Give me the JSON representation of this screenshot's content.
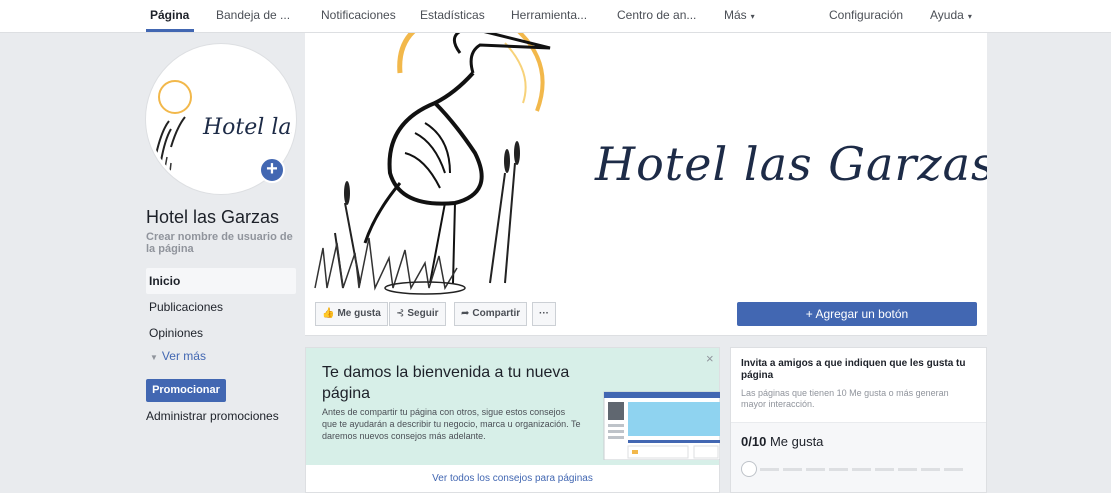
{
  "nav": {
    "items": [
      "Página",
      "Bandeja de ...",
      "Notificaciones",
      "Estadísticas",
      "Herramienta...",
      "Centro de an...",
      "Más",
      "Configuración",
      "Ayuda"
    ],
    "caret": "▾"
  },
  "sidebar": {
    "page_name": "Hotel las Garzas",
    "username_link": "Crear nombre de usuario de la página",
    "profile_text": "Hotel las (",
    "add_icon": "+",
    "nav_items": [
      "Inicio",
      "Publicaciones",
      "Opiniones"
    ],
    "see_more": "Ver más",
    "see_more_icon": "▼",
    "promote": "Promocionar",
    "manage_promos": "Administrar promociones"
  },
  "cover": {
    "title": "Hotel las Garzas"
  },
  "actions": {
    "like": "Me gusta",
    "like_icon": "👍",
    "follow": "Seguir",
    "follow_icon": "⊰",
    "share": "Compartir",
    "share_icon": "➦",
    "more": "···",
    "add_button": "+ Agregar un botón"
  },
  "welcome": {
    "title": "Te damos la bienvenida a tu nueva página",
    "body": "Antes de compartir tu página con otros, sigue estos consejos que te ayudarán a describir tu negocio, marca u organización. Te daremos nuevos consejos más adelante.",
    "close": "×",
    "link": "Ver todos los consejos para páginas"
  },
  "invite": {
    "title": "Invita a amigos a que indiquen que les gusta tu página",
    "subtitle": "Las páginas que tienen 10 Me gusta o más generan mayor interacción.",
    "count": "0/10",
    "count_label": "Me gusta",
    "progress": 0
  },
  "colors": {
    "accent": "#4267b2",
    "background": "#e9ebee",
    "welcome_bg": "#d7efe8"
  }
}
